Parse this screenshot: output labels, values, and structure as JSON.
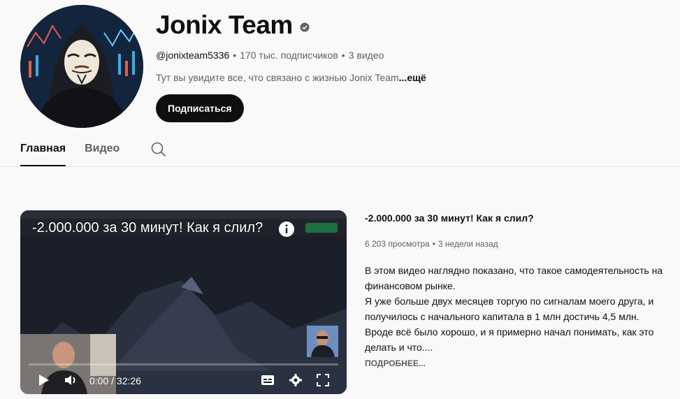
{
  "channel": {
    "title": "Jonix Team",
    "handle": "@jonixteam5336",
    "subscribers": "170 тыс. подписчиков",
    "video_count": "3 видео",
    "separator": "•",
    "description": "Тут вы увидите все, что связано с жизнью Jonix Team",
    "description_more": "...ещё",
    "subscribe_label": "Подписаться"
  },
  "tabs": [
    {
      "label": "Главная",
      "active": true
    },
    {
      "label": "Видео",
      "active": false
    }
  ],
  "icons": {
    "verified": "verified-check-icon",
    "search": "search-icon",
    "info": "info-icon",
    "play": "play-icon",
    "volume": "volume-icon",
    "subtitles": "subtitles-icon",
    "settings": "gear-icon",
    "fullscreen": "fullscreen-icon"
  },
  "featured_video": {
    "player_title": "-2.000.000 за 30 минут! Как я слил?",
    "time": "0:00 / 32:26",
    "progress": 0,
    "title": "-2.000.000 за 30 минут! Как я слил?",
    "views": "6 203 просмотра",
    "age": "3 недели назад",
    "description_lines": [
      "В этом видео наглядно показано, что такое самодеятельность на финансовом рынке.",
      "Я уже больше двух месяцев торгую по сигналам моего друга, и получилось с начального капитала в 1 млн достичь 4,5 млн.",
      "Вроде всё было хорошо, и я примерно начал понимать, как это делать и что...."
    ],
    "more_label": "ПОДРОБНЕЕ..."
  },
  "colors": {
    "background": "#f9f9f9",
    "text_primary": "#0f0f0f",
    "text_secondary": "#606060",
    "subscribe_bg": "#0f0f0f",
    "divider": "#e5e5e5"
  }
}
